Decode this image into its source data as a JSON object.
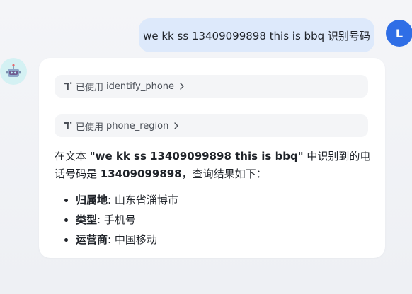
{
  "user": {
    "message": "we kk ss 13409099898 this is bbq 识别号码",
    "avatar_letter": "L",
    "avatar_color": "#2f6ee6"
  },
  "bot": {
    "avatar_icon": "robot-avatar-icon",
    "tools": [
      {
        "prefix": "已使用",
        "name": "identify_phone",
        "icon": "tool-icon"
      },
      {
        "prefix": "已使用",
        "name": "phone_region",
        "icon": "tool-icon"
      }
    ],
    "answer": {
      "intro_1": "在文本 ",
      "quoted": "\"we kk ss 13409099898 this is bbq\"",
      "intro_2": " 中识别到的电话号码是 ",
      "number": "13409099898",
      "intro_3": "，查询结果如下：",
      "items": [
        {
          "key": "归属地",
          "value": ": 山东省淄博市"
        },
        {
          "key": "类型",
          "value": ": 手机号"
        },
        {
          "key": "运营商",
          "value": ": 中国移动"
        }
      ]
    }
  },
  "colors": {
    "user_bubble": "#dde9fb",
    "bot_avatar_bg": "#d4f1f3",
    "tool_chip_bg": "#f4f5f7"
  }
}
